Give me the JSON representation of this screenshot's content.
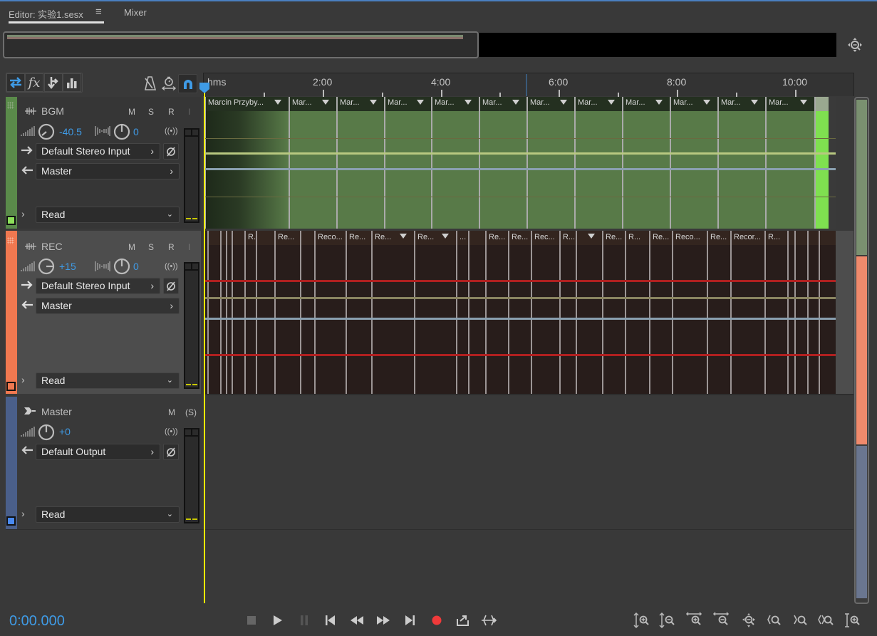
{
  "tabs": [
    {
      "label": "Editor: 实验1.sesx",
      "active": true
    },
    {
      "label": "Mixer",
      "active": false
    }
  ],
  "toolbar": {
    "left_buttons": [
      "inputs-outputs-icon",
      "fx-icon",
      "sends-icon",
      "eq-icon"
    ],
    "right_buttons": [
      "metronome-icon",
      "time-stretch-icon",
      "snapping-icon"
    ]
  },
  "ruler": {
    "unit_label": "hms",
    "labels": [
      "2:00",
      "4:00",
      "6:00",
      "8:00",
      "10:00"
    ]
  },
  "tracks": [
    {
      "name": "BGM",
      "color": "#5a8a4a",
      "mute": "M",
      "solo": "S",
      "arm": "R",
      "input_monitor": "I",
      "volume": "-40.5",
      "pan": "0",
      "input": "Default Stereo Input",
      "output": "Master",
      "automation": "Read"
    },
    {
      "name": "REC",
      "color": "#f07850",
      "mute": "M",
      "solo": "S",
      "arm": "R",
      "input_monitor": "I",
      "volume": "+15",
      "pan": "0",
      "input": "Default Stereo Input",
      "output": "Master",
      "automation": "Read"
    },
    {
      "name": "Master",
      "color": "#4a5f8a",
      "mute": "M",
      "solo": "(S)",
      "volume": "+0",
      "output": "Default Output",
      "automation": "Read"
    }
  ],
  "bgm_clips": [
    {
      "label": "Marcin Przyby..."
    },
    {
      "label": "Mar..."
    },
    {
      "label": "Mar..."
    },
    {
      "label": "Mar..."
    },
    {
      "label": "Mar..."
    },
    {
      "label": "Mar..."
    },
    {
      "label": "Mar..."
    },
    {
      "label": "Mar..."
    },
    {
      "label": "Mar..."
    },
    {
      "label": "Mar..."
    },
    {
      "label": "Mar..."
    },
    {
      "label": "Mar..."
    },
    {
      "label": ""
    }
  ],
  "rec_clips": [
    {
      "label": ""
    },
    {
      "label": ""
    },
    {
      "label": ""
    },
    {
      "label": ""
    },
    {
      "label": "R..."
    },
    {
      "label": ""
    },
    {
      "label": "Re..."
    },
    {
      "label": ""
    },
    {
      "label": "Reco..."
    },
    {
      "label": "Re..."
    },
    {
      "label": "Re..."
    },
    {
      "label": "Re..."
    },
    {
      "label": "..."
    },
    {
      "label": ""
    },
    {
      "label": "Re..."
    },
    {
      "label": "Re..."
    },
    {
      "label": "Rec..."
    },
    {
      "label": "R..."
    },
    {
      "label": ""
    },
    {
      "label": "Re..."
    },
    {
      "label": "R..."
    },
    {
      "label": "Re..."
    },
    {
      "label": "Reco..."
    },
    {
      "label": "Re..."
    },
    {
      "label": "Recor..."
    },
    {
      "label": "R..."
    },
    {
      "label": ""
    },
    {
      "label": ""
    },
    {
      "label": ""
    },
    {
      "label": ""
    }
  ],
  "transport": {
    "time": "0:00.000",
    "buttons": [
      "stop",
      "play",
      "pause",
      "go-to-start",
      "rewind",
      "fast-forward",
      "go-to-end",
      "record",
      "loop",
      "skip-selection"
    ]
  },
  "zoom_buttons": [
    "zoom-in-amplitude",
    "zoom-out-amplitude",
    "zoom-in-time",
    "zoom-out-time",
    "zoom-out-full",
    "zoom-in-point-in",
    "zoom-in-point-out",
    "zoom-to-selection",
    "zoom-in-tracks"
  ]
}
